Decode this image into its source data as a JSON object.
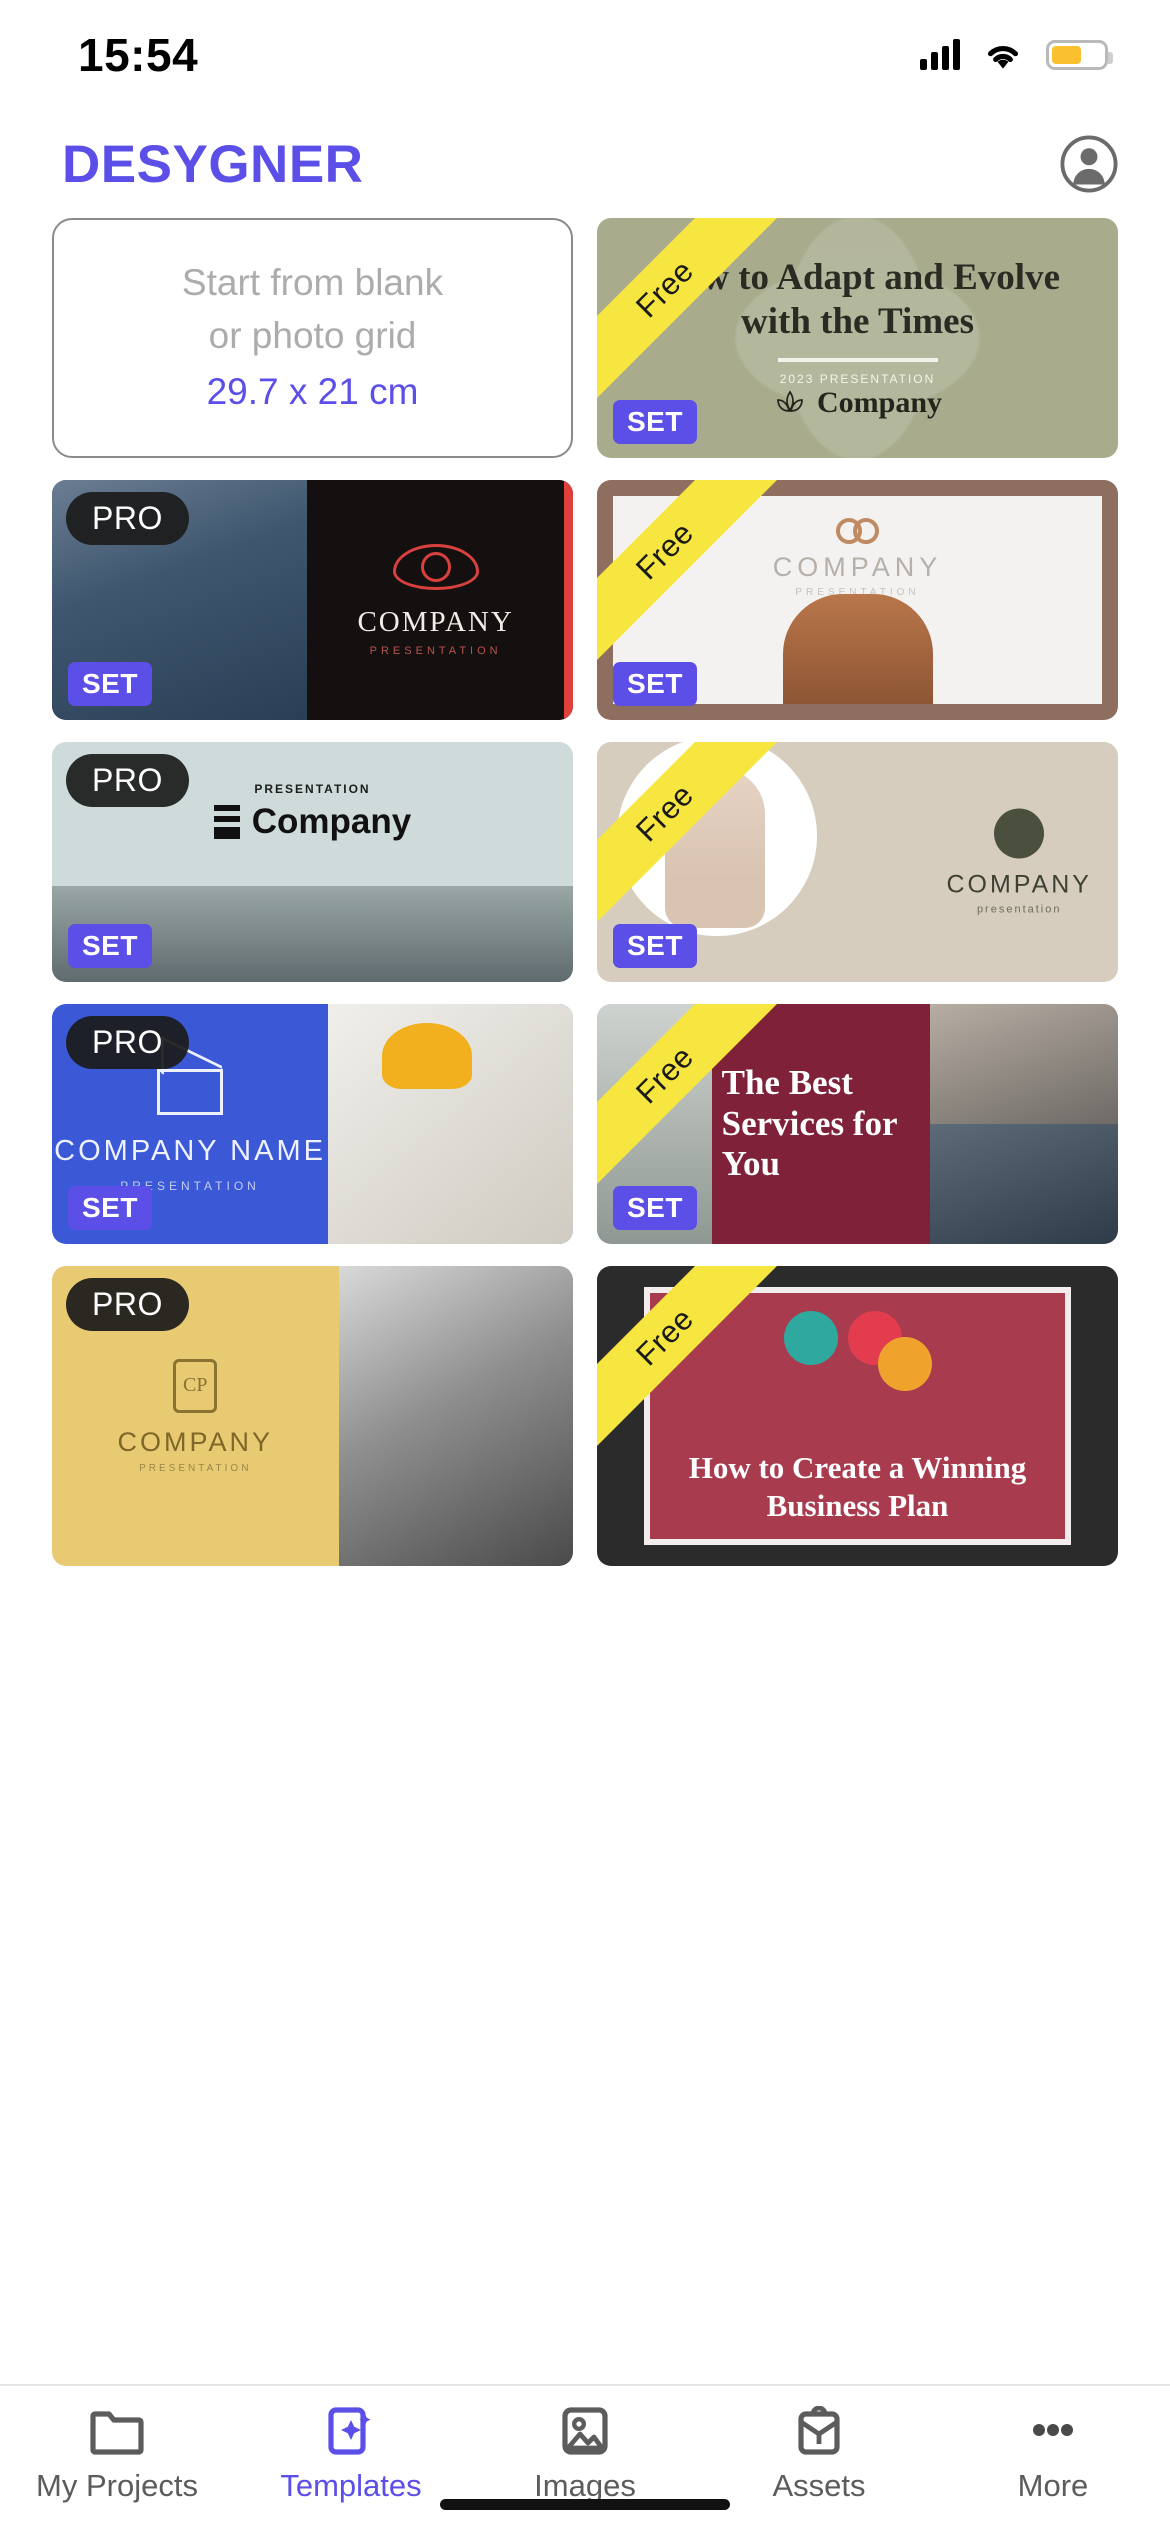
{
  "status_bar": {
    "time": "15:54",
    "signal_icon": "signal-bars-icon",
    "wifi_icon": "wifi-icon",
    "battery_icon": "battery-icon",
    "battery_color": "#FBC02D"
  },
  "header": {
    "brand": "DESYGNER",
    "brand_color": "#5B4FE8",
    "account_icon": "account-circle-icon"
  },
  "blank_card": {
    "line1": "Start from blank",
    "line2": "or photo grid",
    "dimensions": "29.7 x 21 cm"
  },
  "badges": {
    "free": "Free",
    "pro": "PRO",
    "set": "SET",
    "set_color": "#5B4FE8",
    "free_color": "#F7E63F",
    "pro_color": "#1C1C1C"
  },
  "templates": [
    {
      "id": "adapt-evolve",
      "badge": "Free",
      "set": "SET",
      "title": "How to Adapt and Evolve with the Times",
      "subtitle": "2023 PRESENTATION",
      "company": "Company",
      "logo_icon": "lotus-icon"
    },
    {
      "id": "eye-company",
      "badge": "PRO",
      "set": "SET",
      "company": "COMPANY",
      "subtitle": "PRESENTATION",
      "logo_icon": "eye-icon"
    },
    {
      "id": "frame-company",
      "badge": "Free",
      "set": "SET",
      "company": "COMPANY",
      "subtitle": "PRESENTATION",
      "logo_icon": "rings-icon"
    },
    {
      "id": "pale-company",
      "badge": "PRO",
      "set": "SET",
      "subtitle": "PRESENTATION",
      "company": "Company",
      "logo_icon": "bars-mark-icon"
    },
    {
      "id": "beige-company",
      "badge": "Free",
      "set": "SET",
      "company": "COMPANY",
      "subtitle": "presentation",
      "logo_icon": "leaf-circle-icon"
    },
    {
      "id": "blue-architecture",
      "badge": "PRO",
      "set": "SET",
      "company": "COMPANY NAME",
      "subtitle": "PRESENTATION",
      "logo_icon": "house-icon"
    },
    {
      "id": "best-services",
      "badge": "Free",
      "set": "SET",
      "title": "The Best Services for You"
    },
    {
      "id": "yellow-company",
      "badge": "PRO",
      "company": "COMPANY",
      "subtitle": "PRESENTATION",
      "logo_icon": "monogram-icon"
    },
    {
      "id": "winning-business-plan",
      "badge": "Free",
      "title": "How to Create a Winning Business Plan"
    }
  ],
  "tabbar": {
    "items": [
      {
        "label": "My Projects",
        "icon": "folder-icon",
        "active": false
      },
      {
        "label": "Templates",
        "icon": "templates-icon",
        "active": true
      },
      {
        "label": "Images",
        "icon": "image-icon",
        "active": false
      },
      {
        "label": "Assets",
        "icon": "briefcase-icon",
        "active": false
      },
      {
        "label": "More",
        "icon": "more-dots-icon",
        "active": false
      }
    ],
    "active_color": "#5B4FE8"
  }
}
